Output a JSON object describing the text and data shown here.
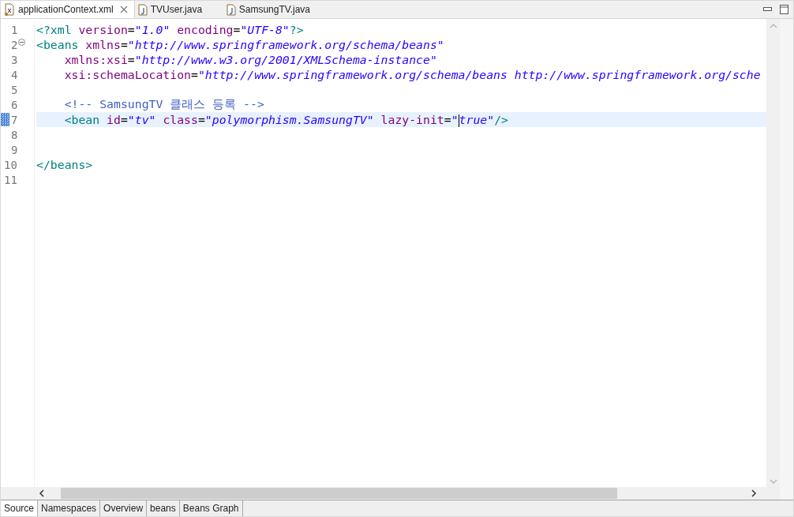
{
  "editor_tabs": [
    {
      "label": "applicationContext.xml",
      "kind": "xml",
      "selected": true,
      "closable": true
    },
    {
      "label": "TVUser.java",
      "kind": "java",
      "selected": false,
      "closable": false
    },
    {
      "label": "SamsungTV.java",
      "kind": "java",
      "selected": false,
      "closable": false
    }
  ],
  "lines": [
    {
      "number": "1",
      "current": false,
      "foldable": false,
      "marker": false,
      "tokens": [
        {
          "kind": "tag",
          "text": "<?xml"
        },
        {
          "kind": "attr",
          "text": " version"
        },
        {
          "kind": "punct",
          "text": "="
        },
        {
          "kind": "value",
          "text": "\"1.0\""
        },
        {
          "kind": "attr",
          "text": " encoding"
        },
        {
          "kind": "punct",
          "text": "="
        },
        {
          "kind": "value",
          "text": "\"UTF-8\""
        },
        {
          "kind": "tag",
          "text": "?>"
        }
      ]
    },
    {
      "number": "2",
      "current": false,
      "foldable": true,
      "marker": false,
      "tokens": [
        {
          "kind": "tag",
          "text": "<beans"
        },
        {
          "kind": "attr",
          "text": " xmlns"
        },
        {
          "kind": "punct",
          "text": "="
        },
        {
          "kind": "value",
          "text": "\"http://www.springframework.org/schema/beans\""
        }
      ]
    },
    {
      "number": "3",
      "current": false,
      "foldable": false,
      "marker": false,
      "tokens": [
        {
          "kind": "attr",
          "text": "    xmlns:xsi"
        },
        {
          "kind": "punct",
          "text": "="
        },
        {
          "kind": "value",
          "text": "\"http://www.w3.org/2001/XMLSchema-instance\""
        }
      ]
    },
    {
      "number": "4",
      "current": false,
      "foldable": false,
      "marker": false,
      "tokens": [
        {
          "kind": "attr",
          "text": "    xsi:schemaLocation"
        },
        {
          "kind": "punct",
          "text": "="
        },
        {
          "kind": "value",
          "text": "\"http://www.springframework.org/schema/beans http://www.springframework.org/sche"
        }
      ]
    },
    {
      "number": "5",
      "current": false,
      "foldable": false,
      "marker": false
    },
    {
      "number": "6",
      "current": false,
      "foldable": false,
      "marker": false,
      "tokens": [
        {
          "kind": "comment",
          "text": "    <!-- SamsungTV 클래스 등록 -->"
        }
      ]
    },
    {
      "number": "7",
      "current": true,
      "foldable": false,
      "marker": true,
      "tokens": [
        {
          "kind": "tag",
          "text": "    <bean"
        },
        {
          "kind": "attr",
          "text": " id"
        },
        {
          "kind": "punct",
          "text": "="
        },
        {
          "kind": "value",
          "text": "\"tv\""
        },
        {
          "kind": "attr",
          "text": " class"
        },
        {
          "kind": "punct",
          "text": "="
        },
        {
          "kind": "value",
          "text": "\"polymorphism.SamsungTV\""
        },
        {
          "kind": "attr",
          "text": " lazy-init"
        },
        {
          "kind": "punct",
          "text": "="
        },
        {
          "kind": "value",
          "text": "\""
        },
        {
          "kind": "caret"
        },
        {
          "kind": "value",
          "text": "true\""
        },
        {
          "kind": "tag",
          "text": "/>"
        }
      ]
    },
    {
      "number": "8",
      "current": false,
      "foldable": false,
      "marker": false
    },
    {
      "number": "9",
      "current": false,
      "foldable": false,
      "marker": false
    },
    {
      "number": "10",
      "current": false,
      "foldable": false,
      "marker": false,
      "tokens": [
        {
          "kind": "tag",
          "text": "</beans>"
        }
      ]
    },
    {
      "number": "11",
      "current": false,
      "foldable": false,
      "marker": false
    }
  ],
  "page_tabs": [
    {
      "label": "Source",
      "selected": true
    },
    {
      "label": "Namespaces",
      "selected": false
    },
    {
      "label": "Overview",
      "selected": false
    },
    {
      "label": "beans",
      "selected": false
    },
    {
      "label": "Beans Graph",
      "selected": false
    }
  ]
}
